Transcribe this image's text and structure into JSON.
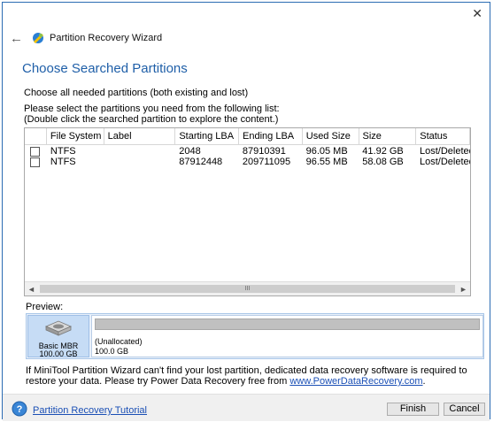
{
  "window": {
    "close_glyph": "✕"
  },
  "header": {
    "back_glyph": "←",
    "title": "Partition Recovery Wizard"
  },
  "heading": "Choose Searched Partitions",
  "subtitle": "Choose all needed partitions (both existing and lost)",
  "instruction_line1": "Please select the partitions you need from the following list:",
  "instruction_line2": "(Double click the searched partition to explore the content.)",
  "table": {
    "columns": [
      "",
      "File System",
      "Label",
      "Starting LBA",
      "Ending LBA",
      "Used Size",
      "Size",
      "Status"
    ],
    "rows": [
      {
        "checked": false,
        "fs": "NTFS",
        "label": "",
        "start": "2048",
        "end": "87910391",
        "used": "96.05 MB",
        "size": "41.92 GB",
        "status": "Lost/Deleted"
      },
      {
        "checked": false,
        "fs": "NTFS",
        "label": "",
        "start": "87912448",
        "end": "209711095",
        "used": "96.55 MB",
        "size": "58.08 GB",
        "status": "Lost/Deleted"
      }
    ]
  },
  "scrollbar": {
    "left": "◄",
    "right": "►",
    "grip": "III"
  },
  "preview": {
    "label": "Preview:",
    "disk": {
      "name": "Basic MBR",
      "size": "100.00 GB"
    },
    "partition": {
      "name": "(Unallocated)",
      "size": "100.0 GB"
    }
  },
  "info": {
    "text": "If MiniTool Partition Wizard can't find your lost partition, dedicated data recovery software is required to restore your data. Please try Power Data Recovery free from ",
    "link": "www.PowerDataRecovery.com",
    "end": "."
  },
  "footer": {
    "tutorial_link": "Partition Recovery Tutorial",
    "finish": "Finish",
    "cancel": "Cancel"
  },
  "colors": {
    "accent": "#1f5fa8",
    "link": "#1a4fb5",
    "border": "#2b6cb3"
  },
  "icons": {
    "back": "back-arrow-icon",
    "wizard": "wizard-icon",
    "help": "help-icon",
    "disk": "hard-disk-icon",
    "close": "close-icon"
  }
}
